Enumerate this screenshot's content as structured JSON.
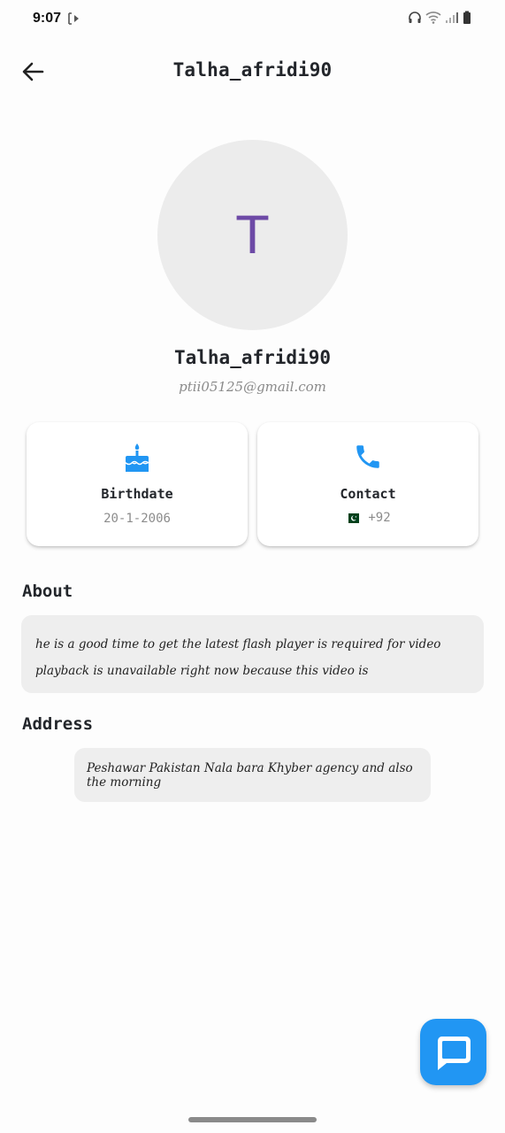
{
  "status_bar": {
    "time": "9:07"
  },
  "app_bar": {
    "title": "Talha_afridi90",
    "back_icon": "arrow-left-icon"
  },
  "profile": {
    "avatar_letter": "T",
    "name": "Talha_afridi90",
    "email": "ptii05125@gmail.com",
    "avatar_letter_color": "#6d4aa6"
  },
  "cards": {
    "birthdate": {
      "icon": "cake-icon",
      "title": "Birthdate",
      "value": "20-1-2006"
    },
    "contact": {
      "icon": "phone-icon",
      "title": "Contact",
      "flag": "pakistan-flag-icon",
      "value": "+92"
    }
  },
  "about": {
    "heading": "About",
    "text": "he is a good time to get the latest flash player is required for video playback is unavailable right now because this video is"
  },
  "address": {
    "heading": "Address",
    "text": "Peshawar Pakistan Nala bara Khyber agency and also the morning"
  },
  "fab": {
    "icon": "chat-icon"
  },
  "colors": {
    "accent": "#2196f3",
    "card_background": "#ffffff",
    "box_background": "#eeeeee"
  }
}
